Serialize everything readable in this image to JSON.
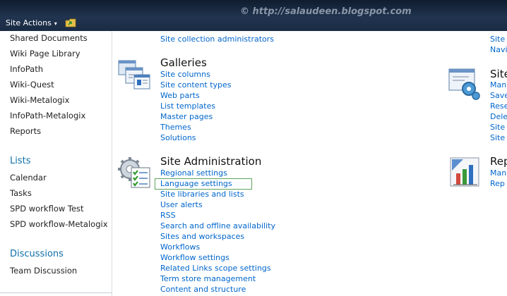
{
  "topbar": {
    "site_actions_label": "Site Actions",
    "site_actions_arrow": "▾",
    "watermark": "© http://salaudeen.blogspot.com"
  },
  "leftnav": {
    "libraries": [
      "Shared Documents",
      "Wiki Page Library",
      "InfoPath",
      "Wiki-Quest",
      "Wiki-Metalogix",
      "InfoPath-Metalogix",
      "Reports"
    ],
    "lists_heading": "Lists",
    "lists": [
      "Calendar",
      "Tasks",
      "SPD workflow Test",
      "SPD workflow-Metalogix"
    ],
    "discussions_heading": "Discussions",
    "discussions": [
      "Team Discussion"
    ]
  },
  "users_permissions": {
    "last_link": "Site collection administrators"
  },
  "galleries": {
    "title": "Galleries",
    "icon": "galleries-icon",
    "links": [
      "Site columns",
      "Site content types",
      "Web parts",
      "List templates",
      "Master pages",
      "Themes",
      "Solutions"
    ]
  },
  "site_administration": {
    "title": "Site Administration",
    "icon": "gear-checklist-icon",
    "links": [
      "Regional settings",
      "Language settings",
      "Site libraries and lists",
      "User alerts",
      "RSS",
      "Search and offline availability",
      "Sites and workspaces",
      "Workflows",
      "Workflow settings",
      "Related Links scope settings",
      "Term store management",
      "Content and structure"
    ],
    "selected": "Language settings"
  },
  "right_column": {
    "top_links": [
      "Site",
      "Navi"
    ],
    "section1_title": "Site",
    "section1_links": [
      "Man",
      "Save",
      "Rese",
      "Dele",
      "Site",
      "Site"
    ],
    "section2_title": "Rep",
    "section2_links": [
      "Man",
      "Rep"
    ]
  },
  "colors": {
    "topbar": "#1b2b44",
    "link": "#0066cc",
    "nav_heading": "#0f6fa8",
    "selection_border": "#5ea35e"
  }
}
